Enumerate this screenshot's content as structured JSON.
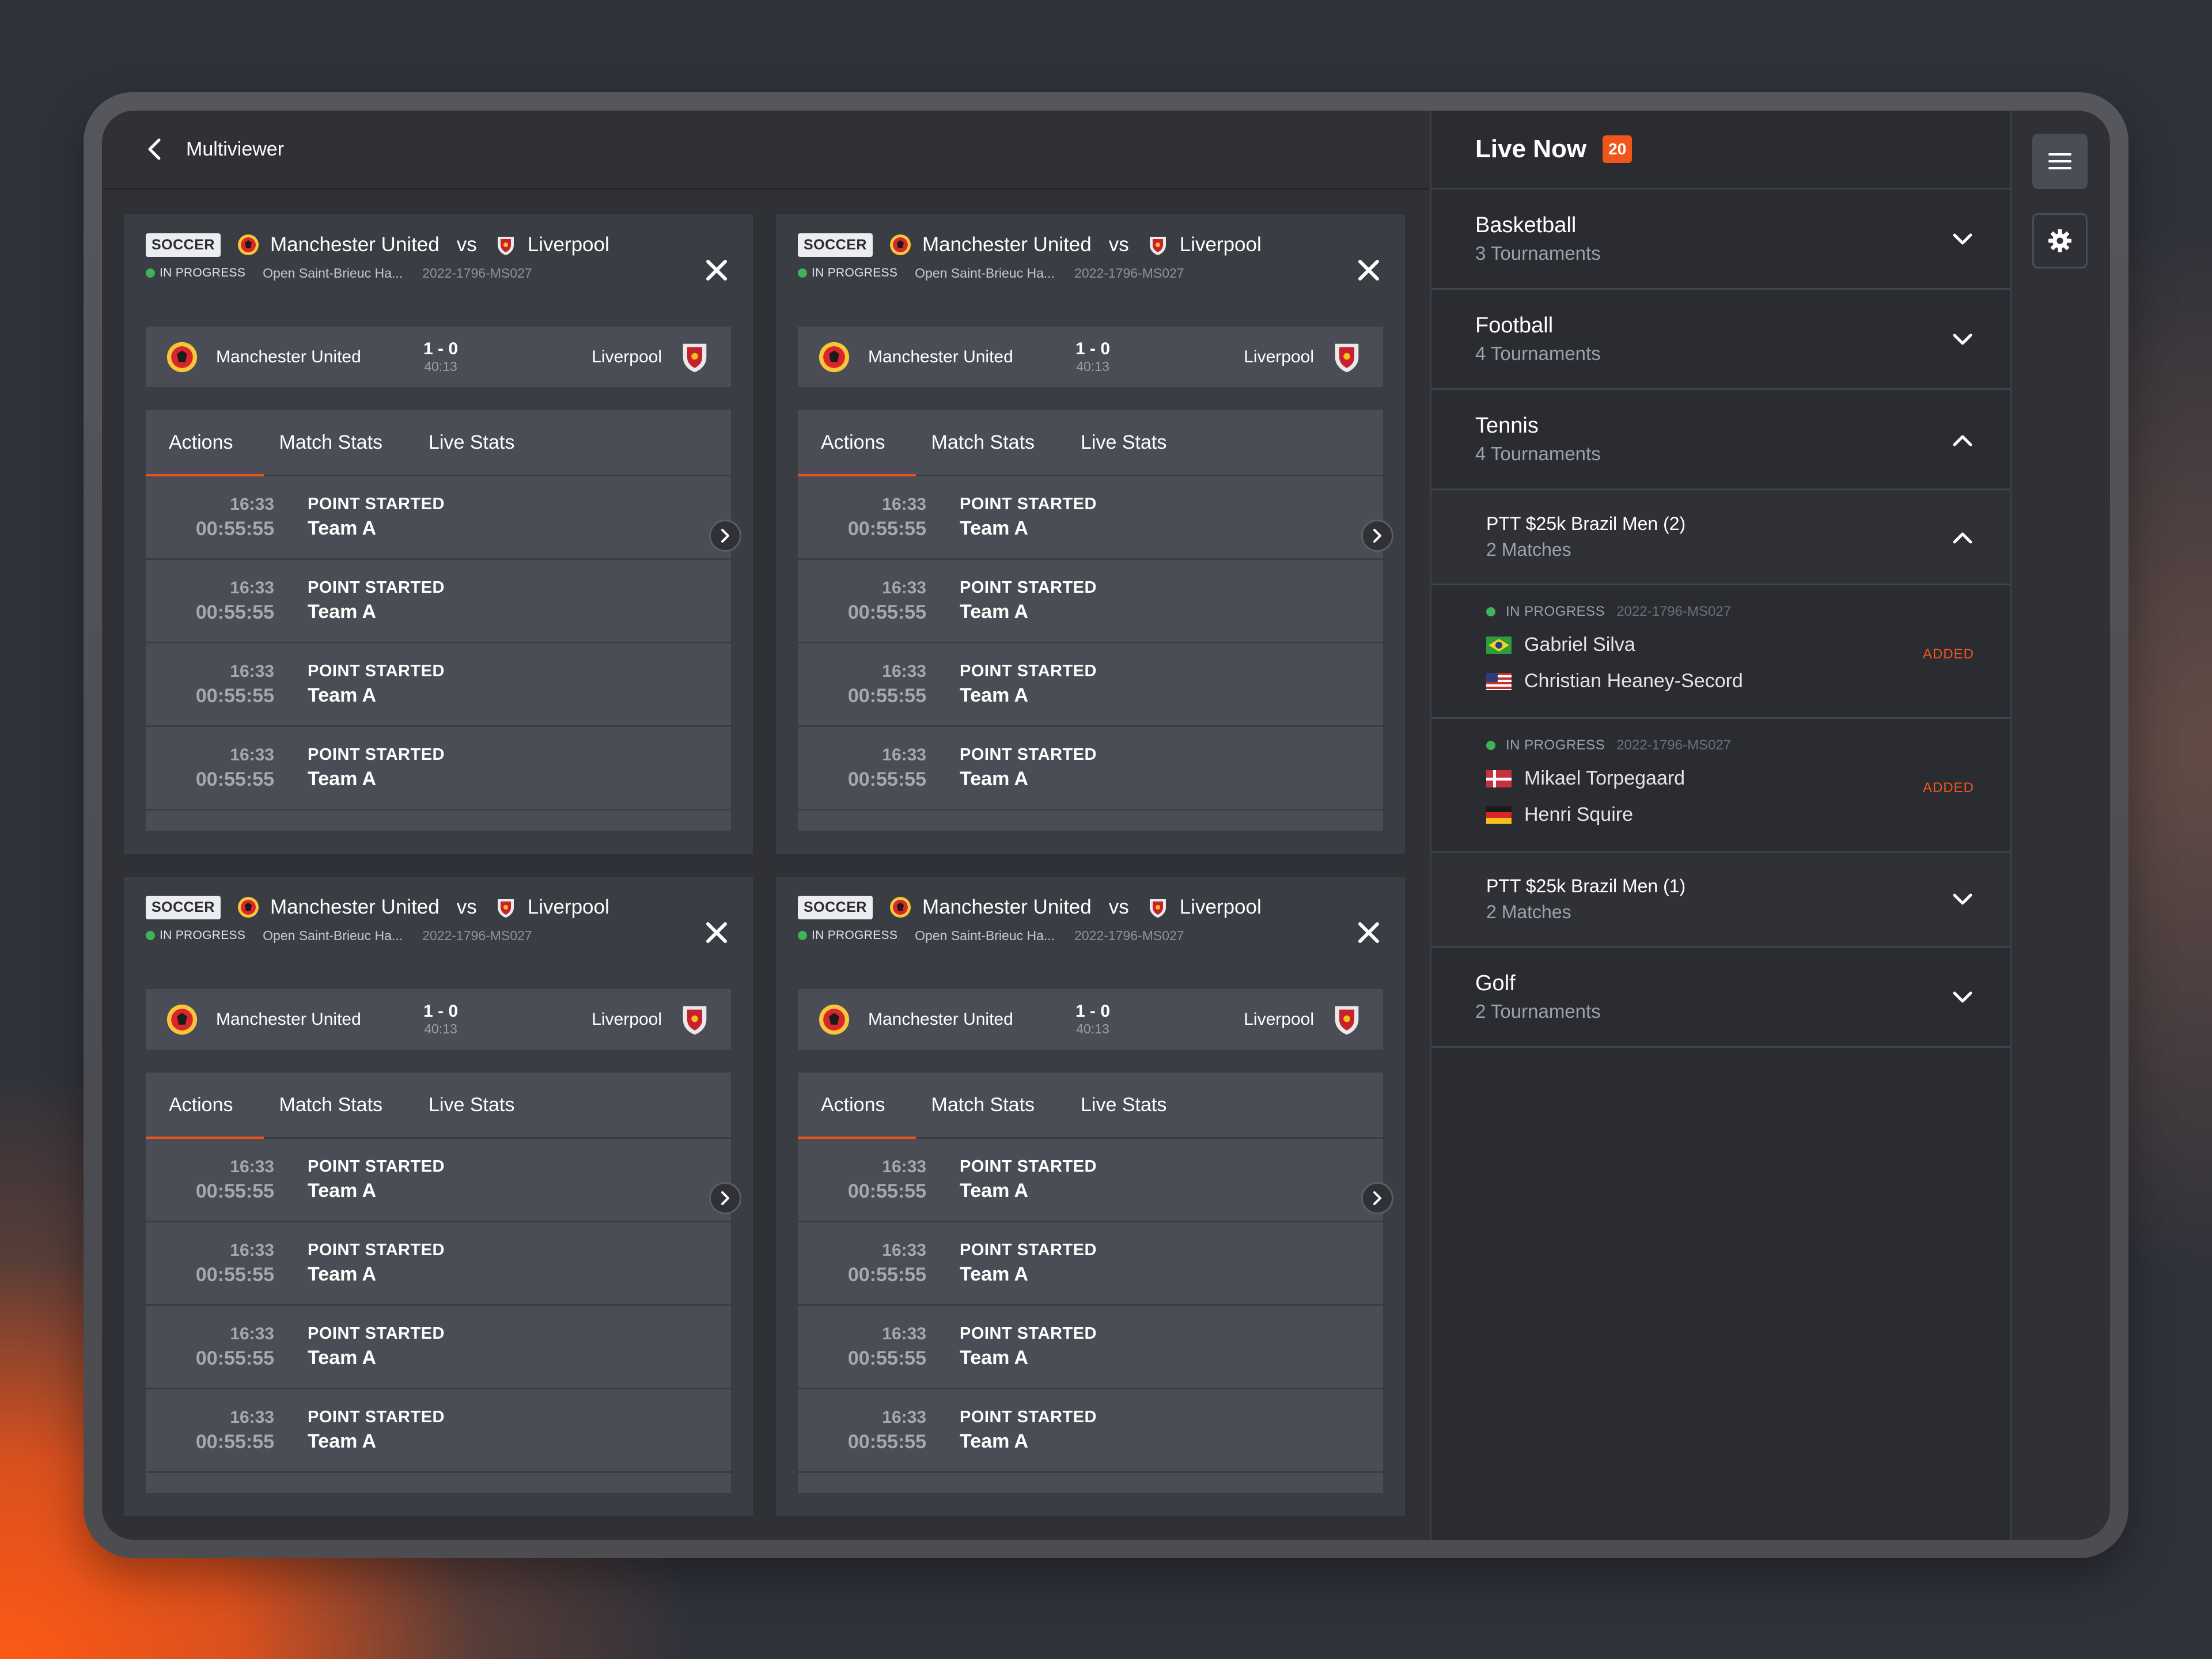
{
  "topbar": {
    "title": "Multiviewer"
  },
  "panels": [
    {
      "sport": "SOCCER",
      "home": "Manchester United",
      "vs": "vs",
      "away": "Liverpool",
      "status": "IN PROGRESS",
      "venue": "Open Saint-Brieuc Ha...",
      "match_id": "2022-1796-MS027",
      "score": "1 - 0",
      "clock": "40:13",
      "tabs": [
        "Actions",
        "Match Stats",
        "Live Stats"
      ],
      "rows": [
        {
          "time": "16:33",
          "elapsed": "00:55:55",
          "event": "POINT STARTED",
          "team": "Team A"
        },
        {
          "time": "16:33",
          "elapsed": "00:55:55",
          "event": "POINT STARTED",
          "team": "Team A"
        },
        {
          "time": "16:33",
          "elapsed": "00:55:55",
          "event": "POINT STARTED",
          "team": "Team A"
        },
        {
          "time": "16:33",
          "elapsed": "00:55:55",
          "event": "POINT STARTED",
          "team": "Team A"
        }
      ]
    },
    {
      "sport": "SOCCER",
      "home": "Manchester United",
      "vs": "vs",
      "away": "Liverpool",
      "status": "IN PROGRESS",
      "venue": "Open Saint-Brieuc Ha...",
      "match_id": "2022-1796-MS027",
      "score": "1 - 0",
      "clock": "40:13",
      "tabs": [
        "Actions",
        "Match Stats",
        "Live Stats"
      ],
      "rows": [
        {
          "time": "16:33",
          "elapsed": "00:55:55",
          "event": "POINT STARTED",
          "team": "Team A"
        },
        {
          "time": "16:33",
          "elapsed": "00:55:55",
          "event": "POINT STARTED",
          "team": "Team A"
        },
        {
          "time": "16:33",
          "elapsed": "00:55:55",
          "event": "POINT STARTED",
          "team": "Team A"
        },
        {
          "time": "16:33",
          "elapsed": "00:55:55",
          "event": "POINT STARTED",
          "team": "Team A"
        }
      ]
    },
    {
      "sport": "SOCCER",
      "home": "Manchester United",
      "vs": "vs",
      "away": "Liverpool",
      "status": "IN PROGRESS",
      "venue": "Open Saint-Brieuc Ha...",
      "match_id": "2022-1796-MS027",
      "score": "1 - 0",
      "clock": "40:13",
      "tabs": [
        "Actions",
        "Match Stats",
        "Live Stats"
      ],
      "rows": [
        {
          "time": "16:33",
          "elapsed": "00:55:55",
          "event": "POINT STARTED",
          "team": "Team A"
        },
        {
          "time": "16:33",
          "elapsed": "00:55:55",
          "event": "POINT STARTED",
          "team": "Team A"
        },
        {
          "time": "16:33",
          "elapsed": "00:55:55",
          "event": "POINT STARTED",
          "team": "Team A"
        },
        {
          "time": "16:33",
          "elapsed": "00:55:55",
          "event": "POINT STARTED",
          "team": "Team A"
        }
      ]
    },
    {
      "sport": "SOCCER",
      "home": "Manchester United",
      "vs": "vs",
      "away": "Liverpool",
      "status": "IN PROGRESS",
      "venue": "Open Saint-Brieuc Ha...",
      "match_id": "2022-1796-MS027",
      "score": "1 - 0",
      "clock": "40:13",
      "tabs": [
        "Actions",
        "Match Stats",
        "Live Stats"
      ],
      "rows": [
        {
          "time": "16:33",
          "elapsed": "00:55:55",
          "event": "POINT STARTED",
          "team": "Team A"
        },
        {
          "time": "16:33",
          "elapsed": "00:55:55",
          "event": "POINT STARTED",
          "team": "Team A"
        },
        {
          "time": "16:33",
          "elapsed": "00:55:55",
          "event": "POINT STARTED",
          "team": "Team A"
        },
        {
          "time": "16:33",
          "elapsed": "00:55:55",
          "event": "POINT STARTED",
          "team": "Team A"
        }
      ]
    }
  ],
  "live": {
    "title": "Live Now",
    "count": "20",
    "sports": [
      {
        "name": "Basketball",
        "sub": "3 Tournaments"
      },
      {
        "name": "Football",
        "sub": "4 Tournaments"
      },
      {
        "name": "Tennis",
        "sub": "4 Tournaments"
      },
      {
        "name": "Golf",
        "sub": "2 Tournaments"
      }
    ],
    "tournaments": [
      {
        "name": "PTT $25k Brazil Men (2)",
        "sub": "2 Matches"
      },
      {
        "name": "PTT $25k Brazil Men (1)",
        "sub": "2 Matches"
      }
    ],
    "matches": [
      {
        "status": "IN PROGRESS",
        "id": "2022-1796-MS027",
        "p1": "Gabriel Silva",
        "p1_flag": "brazil-flag",
        "p2": "Christian Heaney-Secord",
        "p2_flag": "usa-flag",
        "badge": "ADDED"
      },
      {
        "status": "IN PROGRESS",
        "id": "2022-1796-MS027",
        "p1": "Mikael Torpegaard",
        "p1_flag": "denmark-flag",
        "p2": "Henri Squire",
        "p2_flag": "germany-flag",
        "badge": "ADDED"
      }
    ]
  },
  "colors": {
    "accent": "#f0561a",
    "live_dot": "#3fb35a",
    "panel_bg": "#3a3d44",
    "card_bg": "#4a4d55"
  }
}
